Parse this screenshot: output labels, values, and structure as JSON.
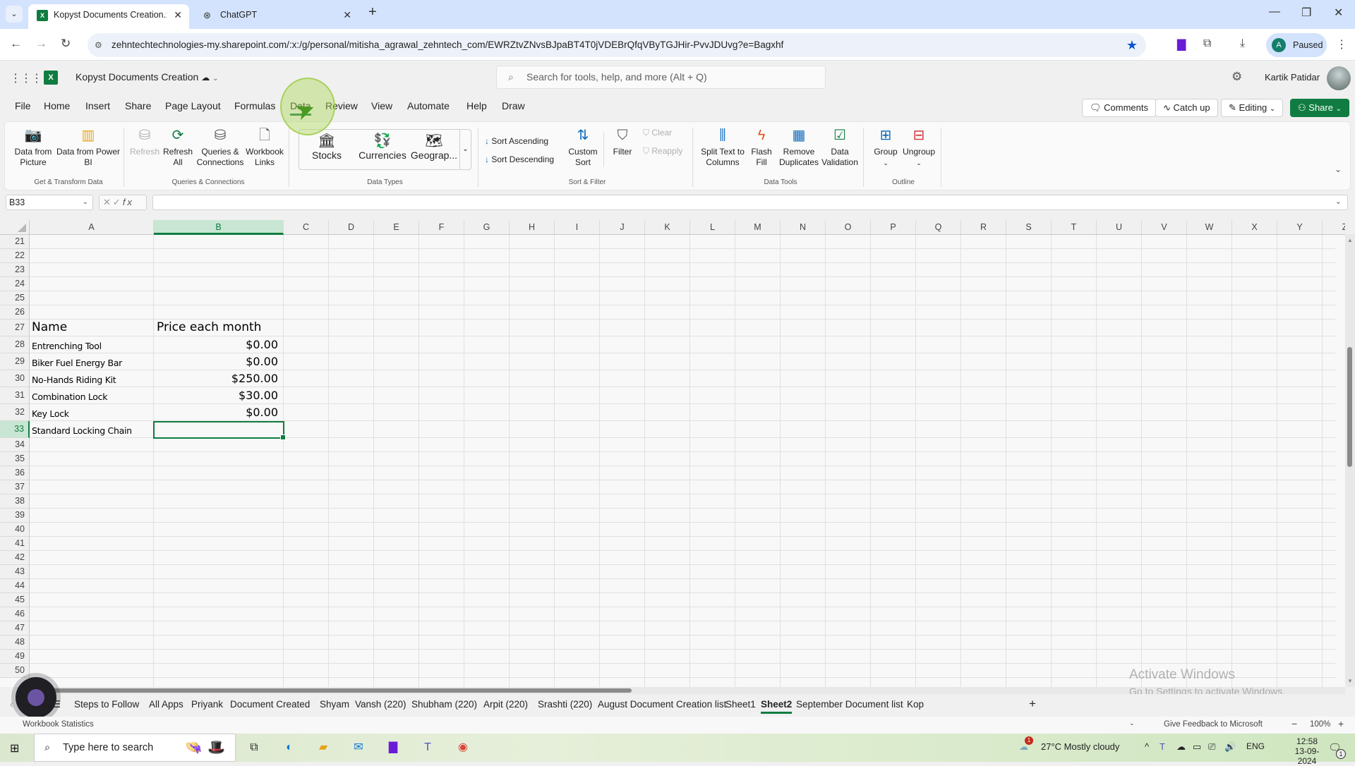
{
  "browser": {
    "tabs": [
      {
        "title": "Kopyst Documents Creation.xlsx",
        "active": true,
        "icon": "excel-icon"
      },
      {
        "title": "ChatGPT",
        "active": false,
        "icon": "chatgpt-icon"
      }
    ],
    "url": "zehntechtechnologies-my.sharepoint.com/:x:/g/personal/mitisha_agrawal_zehntech_com/EWRZtvZNvsBJpaBT4T0jVDEBrQfqVByTGJHir-PvvJDUvg?e=Bagxhf",
    "profile_initial": "A",
    "profile_status": "Paused"
  },
  "excel": {
    "doc_title": "Kopyst Documents Creation",
    "search_placeholder": "Search for tools, help, and more (Alt + Q)",
    "user_name": "Kartik Patidar",
    "menus": [
      "File",
      "Home",
      "Insert",
      "Share",
      "Page Layout",
      "Formulas",
      "Data",
      "Review",
      "View",
      "Automate",
      "Help",
      "Draw"
    ],
    "active_menu": "Data",
    "header_buttons": {
      "comments": "Comments",
      "catch_up": "Catch up",
      "editing": "Editing",
      "share": "Share"
    },
    "ribbon": {
      "get_transform": {
        "label": "Get & Transform Data",
        "buttons": [
          {
            "line1": "Data from",
            "line2": "Picture"
          },
          {
            "line1": "Data from Power",
            "line2": "BI"
          }
        ]
      },
      "queries": {
        "label": "Queries & Connections",
        "buttons": [
          {
            "line1": "Refresh",
            "line2": "",
            "disabled": true
          },
          {
            "line1": "Refresh",
            "line2": "All"
          },
          {
            "line1": "Queries &",
            "line2": "Connections"
          },
          {
            "line1": "Workbook",
            "line2": "Links"
          }
        ]
      },
      "data_types": {
        "label": "Data Types",
        "buttons": [
          "Stocks",
          "Currencies",
          "Geograp..."
        ]
      },
      "sort_filter": {
        "label": "Sort & Filter",
        "sort_asc": "Sort Ascending",
        "sort_desc": "Sort Descending",
        "custom_sort": {
          "line1": "Custom",
          "line2": "Sort"
        },
        "filter": "Filter",
        "clear": "Clear",
        "reapply": "Reapply"
      },
      "data_tools": {
        "label": "Data Tools",
        "buttons": [
          {
            "line1": "Split Text to",
            "line2": "Columns"
          },
          {
            "line1": "Flash",
            "line2": "Fill"
          },
          {
            "line1": "Remove",
            "line2": "Duplicates"
          },
          {
            "line1": "Data",
            "line2": "Validation"
          }
        ]
      },
      "outline": {
        "label": "Outline",
        "buttons": [
          "Group",
          "Ungroup"
        ]
      }
    },
    "name_box": "B33",
    "formula_value": "",
    "columns": [
      "A",
      "B",
      "C",
      "D",
      "E",
      "F",
      "G",
      "H",
      "I",
      "J",
      "K",
      "L",
      "M",
      "N",
      "O",
      "P",
      "Q",
      "R",
      "S",
      "T",
      "U",
      "V",
      "W",
      "X",
      "Y",
      "Z"
    ],
    "selected_column": "B",
    "rows": [
      21,
      22,
      23,
      24,
      25,
      26,
      27,
      28,
      29,
      30,
      31,
      32,
      33,
      34,
      35,
      36,
      37,
      38,
      39,
      40,
      41,
      42,
      43,
      44,
      45,
      46,
      47,
      48,
      49,
      50
    ],
    "selected_row": 33,
    "table": {
      "header": {
        "name": "Name",
        "price": "Price each month"
      },
      "items": [
        {
          "row": 28,
          "name": "Entrenching Tool",
          "price": "$0.00"
        },
        {
          "row": 29,
          "name": "Biker Fuel Energy Bar",
          "price": "$0.00"
        },
        {
          "row": 30,
          "name": "No-Hands Riding Kit",
          "price": "$250.00"
        },
        {
          "row": 31,
          "name": "Combination Lock",
          "price": "$30.00"
        },
        {
          "row": 32,
          "name": "Key Lock",
          "price": "$0.00"
        },
        {
          "row": 33,
          "name": "Standard Locking Chain",
          "price": ""
        }
      ]
    },
    "sheet_tabs": [
      "Steps to Follow",
      "All Apps",
      "Priyank",
      "Document Created",
      "Shyam",
      "Vansh (220)",
      "Shubham (220)",
      "Arpit (220)",
      "Srashti (220)",
      "August Document Creation list",
      "Sheet1",
      "Sheet2",
      "September Document list",
      "Kop"
    ],
    "active_sheet": "Sheet2",
    "status": {
      "left": "Workbook Statistics",
      "feedback": "Give Feedback to Microsoft",
      "zoom": "100%"
    },
    "watermark": {
      "title": "Activate Windows",
      "subtitle": "Go to Settings to activate Windows."
    }
  },
  "taskbar": {
    "search_placeholder": "Type here to search",
    "weather": "27°C  Mostly cloudy",
    "weather_badge": "1",
    "language": "ENG",
    "time": "12:58",
    "date": "13-09-2024",
    "notification_count": "1"
  }
}
